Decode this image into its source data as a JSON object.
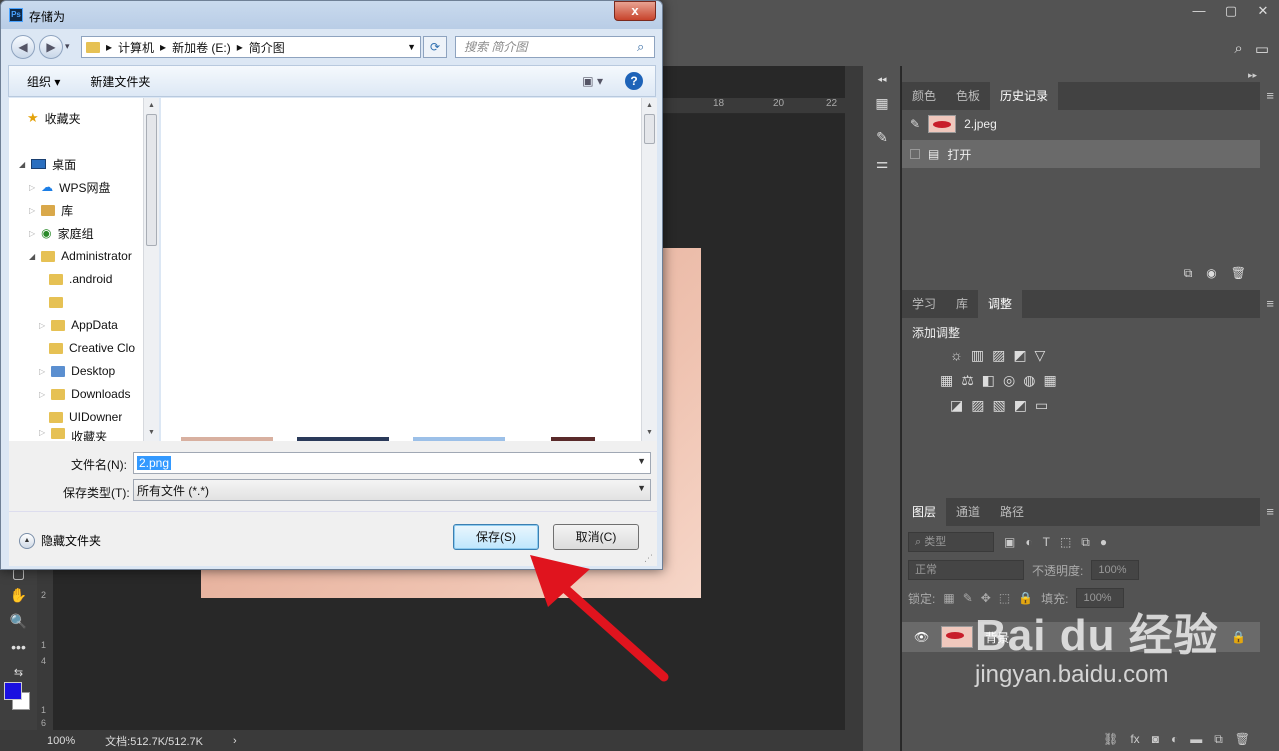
{
  "dialog": {
    "title": "存储为",
    "close_label": "x",
    "address": {
      "parts": [
        "计算机",
        "新加卷 (E:)",
        "简介图"
      ],
      "separator": "▸"
    },
    "search_placeholder": "搜索 简介图",
    "toolbar": {
      "organize": "组织 ▾",
      "new_folder": "新建文件夹"
    },
    "nav": {
      "favorites": "收藏夹",
      "desktop": "桌面",
      "items": [
        "WPS网盘",
        "库",
        "家庭组",
        "Administrator",
        ".android",
        "",
        "AppData",
        "Creative Clo",
        "Desktop",
        "Downloads",
        "UIDowner",
        "收藏夹"
      ]
    },
    "filename_label": "文件名(N):",
    "filename_value": "2.png",
    "filetype_label": "保存类型(T):",
    "filetype_value": "所有文件 (*.*)",
    "hide_folders": "隐藏文件夹",
    "save_button": "保存(S)",
    "cancel_button": "取消(C)"
  },
  "ps": {
    "ruler_ticks": [
      "18",
      "20",
      "22"
    ],
    "ruler_left_ticks": [
      "2",
      "1",
      "4",
      "1",
      "6"
    ],
    "zoom": "100%",
    "doc_size": "文档:512.7K/512.7K",
    "history_tabs": [
      "颜色",
      "色板",
      "历史记录"
    ],
    "history_file": "2.jpeg",
    "history_step": "打开",
    "adjust_tabs": [
      "学习",
      "库",
      "调整"
    ],
    "adjust_title": "添加调整",
    "layer_tabs": [
      "图层",
      "通道",
      "路径"
    ],
    "layer_kind": "类型",
    "blend_mode": "正常",
    "opacity_label": "不透明度:",
    "opacity_value": "100%",
    "lock_label": "锁定:",
    "fill_label": "填充:",
    "fill_value": "100%",
    "layer_name": "背景"
  },
  "watermark": {
    "line1": "Bai du 经验",
    "line2": "jingyan.baidu.com"
  },
  "colors": {
    "ps_bg": "#535353",
    "canvas_bg": "#282828",
    "arrow": "#e0141e",
    "accent": "#3c7fb1",
    "fg_color": "#1a10e0"
  }
}
